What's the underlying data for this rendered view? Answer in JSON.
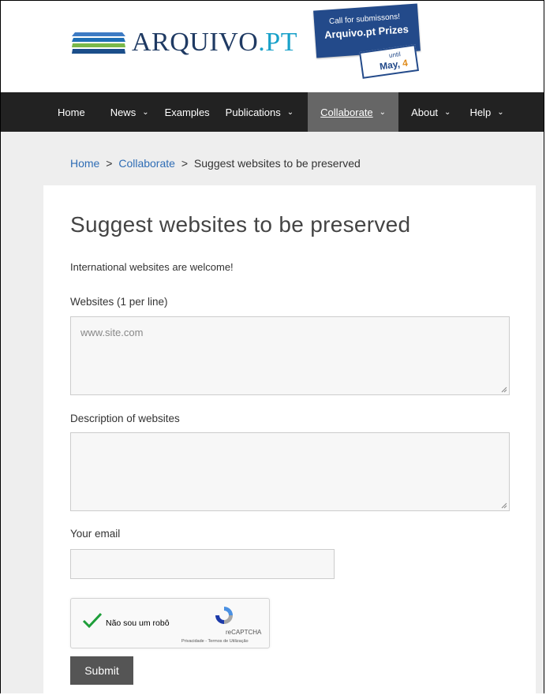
{
  "header": {
    "logo": {
      "name": "ARQUIVO",
      "suffix": ".PT"
    },
    "promo": {
      "line1": "Call for submissons!",
      "line2": "Arquivo.pt Prizes",
      "until": "until",
      "date_prefix": "May, ",
      "date_day": "4",
      "colors": {
        "ribbon": "#234a8a",
        "accent": "#e08b1a"
      }
    }
  },
  "nav": {
    "items": [
      {
        "label": "Home",
        "dropdown": false
      },
      {
        "label": "News",
        "dropdown": true
      },
      {
        "label": "Examples",
        "dropdown": false
      },
      {
        "label": "Publications",
        "dropdown": true
      },
      {
        "label": "Collaborate",
        "dropdown": true,
        "active": true
      },
      {
        "label": "About",
        "dropdown": true
      },
      {
        "label": "Help",
        "dropdown": true
      }
    ],
    "chevron": "⌄"
  },
  "breadcrumb": {
    "home": "Home",
    "sep": ">",
    "collaborate": "Collaborate",
    "current": "Suggest websites to be preserved"
  },
  "form": {
    "title": "Suggest websites to be preserved",
    "intro": "International websites are welcome!",
    "websites_label": "Websites (1 per line)",
    "websites_placeholder": "www.site.com",
    "description_label": "Description of websites",
    "email_label": "Your email",
    "captcha": {
      "text": "Não sou um robô",
      "brand": "reCAPTCHA",
      "terms": "Privacidade - Termos de Utilização",
      "checked": true
    },
    "submit_label": "Submit"
  }
}
